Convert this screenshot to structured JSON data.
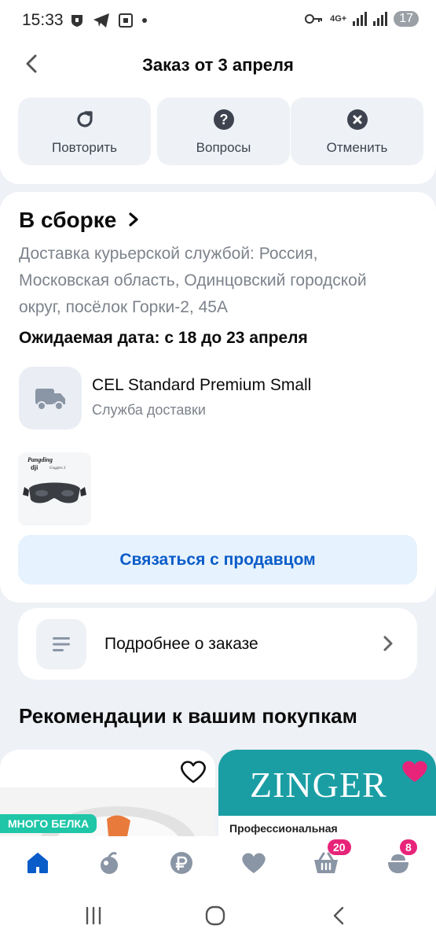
{
  "status_bar": {
    "time": "15:33",
    "battery": "17",
    "network": "4G+"
  },
  "header": {
    "title": "Заказ от 3 апреля"
  },
  "actions": [
    {
      "label": "Повторить",
      "icon": "repeat-icon"
    },
    {
      "label": "Вопросы",
      "icon": "question-icon"
    },
    {
      "label": "Отменить",
      "icon": "cancel-icon"
    }
  ],
  "order": {
    "status": "В сборке",
    "address": "Доставка курьерской службой: Россия, Московская область, Одинцовский городской округ, посёлок Горки-2, 45А",
    "expected_date": "Ожидаемая дата: с 18 до 23 апреля",
    "carrier_name": "CEL Standard Premium Small",
    "carrier_subtitle": "Служба доставки",
    "product_image_text": {
      "brand": "Pangding",
      "model": "Goggles 3"
    },
    "contact_label": "Связаться с продавцом"
  },
  "details": {
    "label": "Подробнее о заказе"
  },
  "recommendations": {
    "title": "Рекомендации к вашим покупкам",
    "card1_badge": "МНОГО БЕЛКА",
    "card2_brand": "ZINGER",
    "card2_desc": "Профессиональная"
  },
  "bottom_nav": {
    "cart_badge": "20",
    "profile_badge": "8"
  },
  "colors": {
    "accent": "#0a5cc9",
    "badge": "#e8247a",
    "green": "#1fc6a8",
    "teal": "#1a9ea4"
  }
}
